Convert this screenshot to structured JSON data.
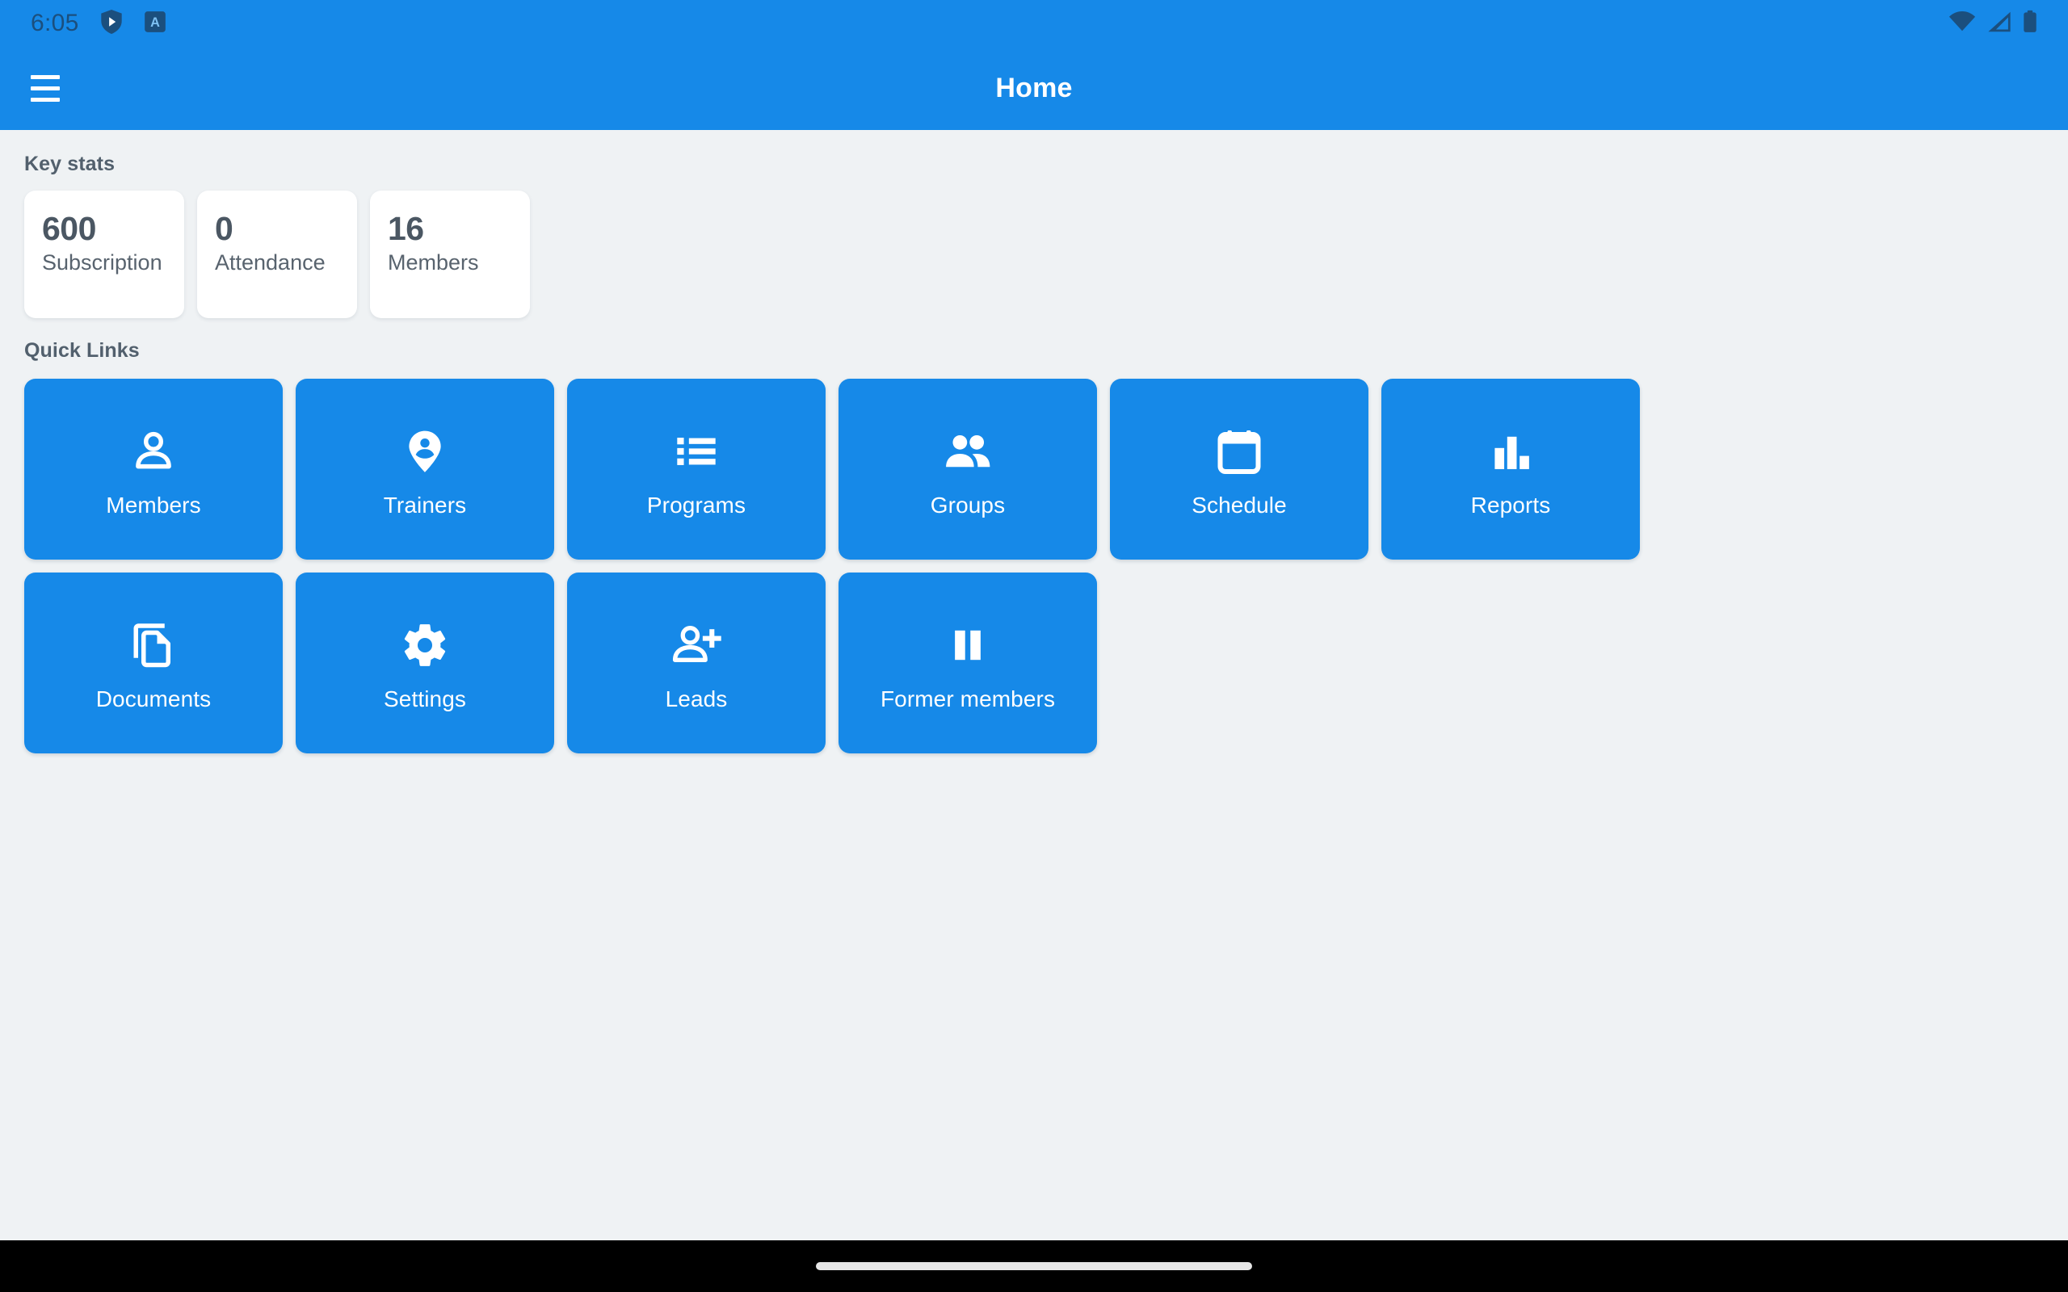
{
  "status_bar": {
    "clock": "6:05",
    "left_icons": [
      "shield-play-icon",
      "app-badge-icon"
    ],
    "right_icons": [
      "wifi-icon",
      "cellular-signal-icon",
      "battery-icon"
    ],
    "icon_color": "#1b4f7e",
    "background": "#1689e8"
  },
  "app_bar": {
    "title": "Home",
    "menu_icon": "hamburger-menu-icon",
    "background": "#1689e8",
    "title_color": "#ffffff"
  },
  "theme": {
    "primary": "#1689e8",
    "page_background": "#eff2f4",
    "card_background": "#ffffff",
    "heading_text": "#52606d",
    "stat_value_text": "#4b5763",
    "tile_text": "#ffffff",
    "nav_bar": "#000000"
  },
  "key_stats": {
    "title": "Key stats",
    "cards": [
      {
        "value": "600",
        "label": "Subscription"
      },
      {
        "value": "0",
        "label": "Attendance"
      },
      {
        "value": "16",
        "label": "Members"
      }
    ]
  },
  "quick_links": {
    "title": "Quick Links",
    "tiles": [
      {
        "label": "Members",
        "icon": "person-outline-icon"
      },
      {
        "label": "Trainers",
        "icon": "person-pin-icon"
      },
      {
        "label": "Programs",
        "icon": "list-bulleted-icon"
      },
      {
        "label": "Groups",
        "icon": "people-filled-icon"
      },
      {
        "label": "Schedule",
        "icon": "calendar-icon"
      },
      {
        "label": "Reports",
        "icon": "bar-chart-icon"
      },
      {
        "label": "Documents",
        "icon": "copy-documents-icon"
      },
      {
        "label": "Settings",
        "icon": "gear-icon"
      },
      {
        "label": "Leads",
        "icon": "person-add-icon"
      },
      {
        "label": "Former members",
        "icon": "pause-icon"
      }
    ]
  },
  "navigation_bar": {
    "gesture_pill": "home-gesture-pill"
  }
}
